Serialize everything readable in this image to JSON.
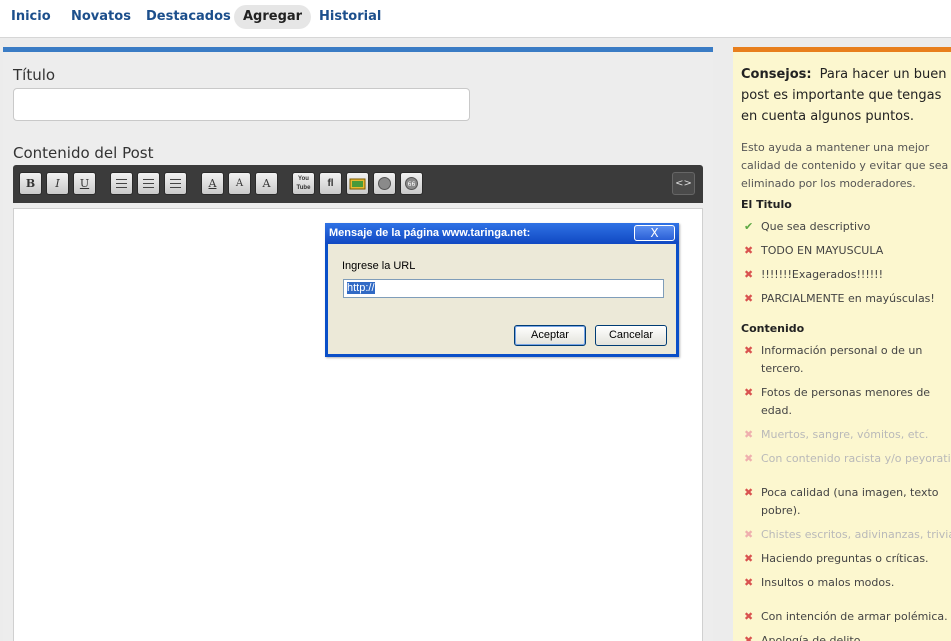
{
  "nav": {
    "items": [
      {
        "label": "Inicio"
      },
      {
        "label": "Novatos"
      },
      {
        "label": "Destacados"
      },
      {
        "label": "Agregar"
      },
      {
        "label": "Historial"
      }
    ]
  },
  "form": {
    "title_label": "Título",
    "content_label": "Contenido del Post"
  },
  "toolbar": {
    "bold": "B",
    "italic": "I",
    "underline": "U",
    "font_color": "A",
    "font_size": "A",
    "font_face": "A",
    "youtube": "You Tube",
    "flash": "fl",
    "html_toggle": "<>"
  },
  "dialog": {
    "title": "Mensaje de la página www.taringa.net:",
    "close": "X",
    "prompt": "Ingrese la URL",
    "value": "http://",
    "accept": "Aceptar",
    "cancel": "Cancelar"
  },
  "tips": {
    "lead_bold": "Consejos:",
    "lead_text": "Para hacer un buen post es importante que tengas en cuenta algunos puntos.",
    "sub": "Esto ayuda a mantener una mejor calidad de contenido y evitar que sea eliminado por los moderadores.",
    "title_heading": "El Titulo",
    "title_rules": [
      {
        "text": "Que sea descriptivo",
        "ok": true
      },
      {
        "text": "TODO EN MAYUSCULA",
        "ok": false
      },
      {
        "text": "!!!!!!!Exagerados!!!!!!",
        "ok": false
      },
      {
        "text": "PARCIALMENTE en mayúsculas!",
        "ok": false
      }
    ],
    "content_heading": "Contenido",
    "content_rules": [
      {
        "text": "Información personal o de un tercero.",
        "ok": false
      },
      {
        "text": "Fotos de personas menores de edad.",
        "ok": false
      },
      {
        "text": "Muertos, sangre, vómitos, etc.",
        "ok": false
      },
      {
        "text": "Con contenido racista y/o peyorativo.",
        "ok": false
      },
      {
        "text": "Poca calidad (una imagen, texto pobre).",
        "ok": false
      },
      {
        "text": "Chistes escritos, adivinanzas, trivias.",
        "ok": false
      },
      {
        "text": "Haciendo preguntas o críticas.",
        "ok": false
      },
      {
        "text": "Insultos o malos modos.",
        "ok": false
      },
      {
        "text": "Con intención de armar polémica.",
        "ok": false
      },
      {
        "text": "Apología de delito.",
        "ok": false
      }
    ]
  },
  "colors": {
    "accent_blue": "#3a7cc5",
    "accent_orange": "#e87f1d",
    "tips_bg": "#fcf7cf"
  }
}
